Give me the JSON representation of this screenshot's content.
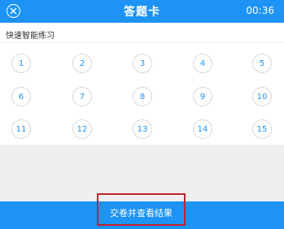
{
  "header": {
    "title": "答题卡",
    "timer": "00:36",
    "close_icon": "close-circle-icon"
  },
  "section": {
    "label": "快速智能练习"
  },
  "questions": [
    "1",
    "2",
    "3",
    "4",
    "5",
    "6",
    "7",
    "8",
    "9",
    "10",
    "11",
    "12",
    "13",
    "14",
    "15"
  ],
  "footer": {
    "submit_label": "交卷并查看结果"
  },
  "colors": {
    "accent": "#1c93f5",
    "highlight_border": "#c0242b",
    "gray_bg": "#efefef"
  }
}
